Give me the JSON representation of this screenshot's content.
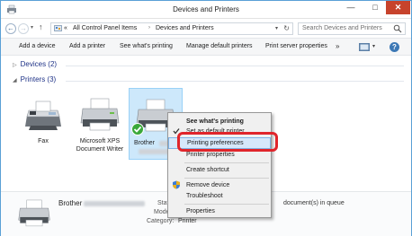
{
  "window": {
    "title": "Devices and Printers"
  },
  "address": {
    "overflow": "«",
    "crumbs": [
      "All Control Panel Items",
      "Devices and Printers"
    ],
    "search_placeholder": "Search Devices and Printers"
  },
  "commands": [
    "Add a device",
    "Add a printer",
    "See what's printing",
    "Manage default printers",
    "Print server properties"
  ],
  "more_commands": "»",
  "groups": {
    "devices": {
      "label": "Devices (2)",
      "arrow": "▷"
    },
    "printers": {
      "label": "Printers (3)",
      "arrow": "◢"
    }
  },
  "printers": [
    {
      "label": "Fax"
    },
    {
      "label": "Microsoft XPS Document Writer"
    },
    {
      "label": "Brother"
    }
  ],
  "context_menu": [
    {
      "label": "See what's printing",
      "bold": true
    },
    {
      "label": "Set as default printer",
      "checked": true
    },
    {
      "label": "Printing preferences",
      "highlighted": true
    },
    {
      "label": "Printer properties"
    },
    {
      "label": "Create shortcut"
    },
    {
      "label": "Remove device",
      "icon": "shield-icon"
    },
    {
      "label": "Troubleshoot"
    },
    {
      "label": "Properties"
    }
  ],
  "details": {
    "name": "Brother",
    "state_label": "Stat",
    "model_label": "Mode",
    "category_label": "Category:",
    "category_value": "Printer",
    "queue_text": "document(s) in queue"
  },
  "colors": {
    "accent": "#5aa0d6",
    "close": "#c7432c",
    "highlight_ring": "#e0252b",
    "selection": "#cde8fb"
  }
}
